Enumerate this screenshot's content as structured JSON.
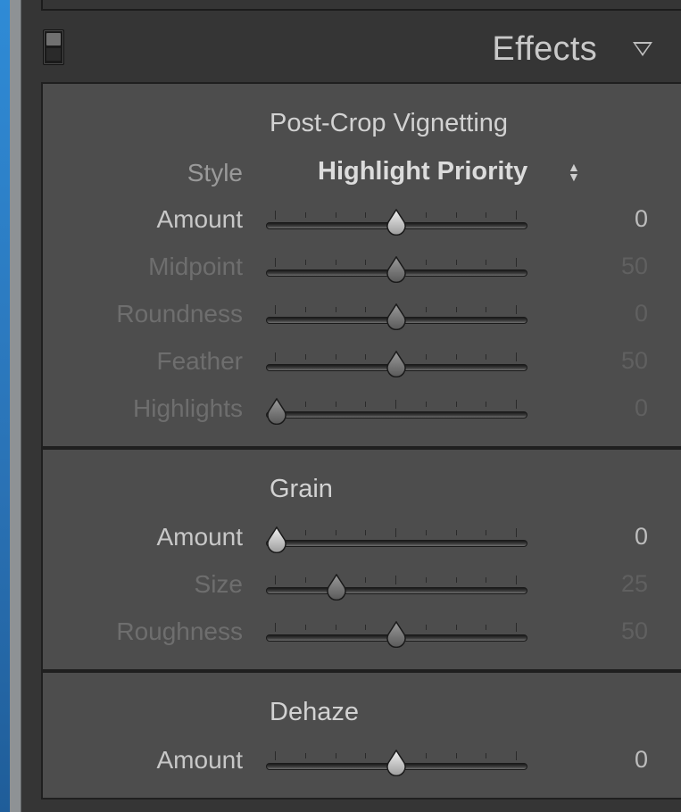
{
  "panel": {
    "title": "Effects",
    "collapse_icon": "triangle-down-icon",
    "toggle_icon": "panel-switch-icon"
  },
  "vignetting": {
    "title": "Post-Crop Vignetting",
    "style_label": "Style",
    "style_value": "Highlight Priority",
    "sliders": [
      {
        "label": "Amount",
        "value": "0",
        "fraction": 0.5,
        "enabled": true
      },
      {
        "label": "Midpoint",
        "value": "50",
        "fraction": 0.5,
        "enabled": false
      },
      {
        "label": "Roundness",
        "value": "0",
        "fraction": 0.5,
        "enabled": false
      },
      {
        "label": "Feather",
        "value": "50",
        "fraction": 0.5,
        "enabled": false
      },
      {
        "label": "Highlights",
        "value": "0",
        "fraction": 0.0,
        "enabled": false
      }
    ]
  },
  "grain": {
    "title": "Grain",
    "sliders": [
      {
        "label": "Amount",
        "value": "0",
        "fraction": 0.0,
        "enabled": true
      },
      {
        "label": "Size",
        "value": "25",
        "fraction": 0.25,
        "enabled": false
      },
      {
        "label": "Roughness",
        "value": "50",
        "fraction": 0.5,
        "enabled": false
      }
    ]
  },
  "dehaze": {
    "title": "Dehaze",
    "sliders": [
      {
        "label": "Amount",
        "value": "0",
        "fraction": 0.5,
        "enabled": true
      }
    ]
  }
}
